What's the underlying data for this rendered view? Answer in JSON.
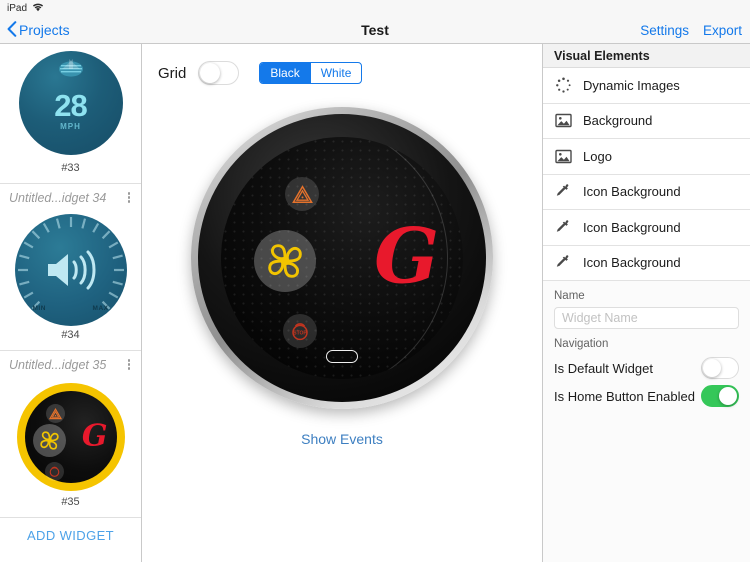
{
  "status_bar": {
    "device": "iPad",
    "wifi_icon": "wifi-icon"
  },
  "navbar": {
    "back_label": "Projects",
    "back_icon": "chevron-left-icon",
    "title": "Test",
    "settings_label": "Settings",
    "export_label": "Export"
  },
  "sidebar": {
    "widgets": [
      {
        "title": "",
        "number": "#33",
        "thumb": "speedometer",
        "value": "28",
        "unit": "MPH",
        "menu_icon": "kebab-menu-icon"
      },
      {
        "title": "Untitled...idget 34",
        "number": "#34",
        "thumb": "volume-dial",
        "min_label": "MIN",
        "max_label": "MAX",
        "menu_icon": "kebab-menu-icon"
      },
      {
        "title": "Untitled...idget 35",
        "number": "#35",
        "thumb": "yellow-widget",
        "menu_icon": "kebab-menu-icon"
      }
    ],
    "add_widget_label": "ADD WIDGET"
  },
  "canvas": {
    "grid_label": "Grid",
    "grid_enabled": false,
    "background_options": [
      "Black",
      "White"
    ],
    "background_selected": "Black",
    "show_events_label": "Show Events",
    "preview": {
      "logo_text": "G",
      "logo_color": "#e8192c",
      "icons": [
        "warning-triangle-icon",
        "fan-icon",
        "brake-stop-icon"
      ],
      "home_button": "home-pill-indicator"
    }
  },
  "inspector": {
    "header": "Visual Elements",
    "rows": [
      {
        "icon": "dynamic-images-icon",
        "label": "Dynamic Images"
      },
      {
        "icon": "image-icon",
        "label": "Background"
      },
      {
        "icon": "image-icon",
        "label": "Logo"
      },
      {
        "icon": "eyedropper-icon",
        "label": "Icon Background"
      },
      {
        "icon": "eyedropper-icon",
        "label": "Icon Background"
      },
      {
        "icon": "eyedropper-icon",
        "label": "Icon Background"
      }
    ],
    "name_section": {
      "label": "Name",
      "value": "",
      "placeholder": "Widget Name"
    },
    "navigation_section": {
      "label": "Navigation",
      "toggles": [
        {
          "label": "Is Default Widget",
          "on": false
        },
        {
          "label": "Is Home Button Enabled",
          "on": true
        }
      ]
    }
  },
  "colors": {
    "accent_blue": "#1479ea",
    "link_blue": "#3d7fc1",
    "toggle_green": "#35c759",
    "logo_red": "#e8192c",
    "widget_yellow": "#f5c400"
  }
}
